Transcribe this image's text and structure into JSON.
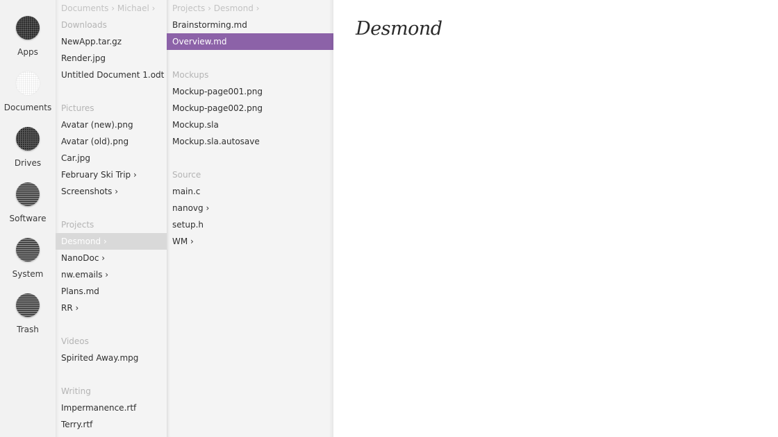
{
  "dock": [
    {
      "label": "Apps",
      "icon": "apps-icon"
    },
    {
      "label": "Documents",
      "icon": "documents-icon"
    },
    {
      "label": "Drives",
      "icon": "drives-icon"
    },
    {
      "label": "Software",
      "icon": "software-icon"
    },
    {
      "label": "System",
      "icon": "system-icon"
    },
    {
      "label": "Trash",
      "icon": "trash-icon"
    }
  ],
  "column1": {
    "breadcrumb": "Documents › Michael ›",
    "rows": [
      {
        "type": "header",
        "text": "Downloads"
      },
      {
        "type": "item",
        "text": "NewApp.tar.gz"
      },
      {
        "type": "item",
        "text": "Render.jpg"
      },
      {
        "type": "item",
        "text": "Untitled Document 1.odt"
      },
      {
        "type": "spacer",
        "text": ""
      },
      {
        "type": "header",
        "text": "Pictures"
      },
      {
        "type": "item",
        "text": "Avatar (new).png"
      },
      {
        "type": "item",
        "text": "Avatar (old).png"
      },
      {
        "type": "item",
        "text": "Car.jpg"
      },
      {
        "type": "item",
        "text": "February Ski Trip ›"
      },
      {
        "type": "item",
        "text": "Screenshots ›"
      },
      {
        "type": "spacer",
        "text": ""
      },
      {
        "type": "header",
        "text": "Projects"
      },
      {
        "type": "item",
        "text": "Desmond ›",
        "selected": "gray"
      },
      {
        "type": "item",
        "text": "NanoDoc ›"
      },
      {
        "type": "item",
        "text": "nw.emails ›"
      },
      {
        "type": "item",
        "text": "Plans.md"
      },
      {
        "type": "item",
        "text": "RR ›"
      },
      {
        "type": "spacer",
        "text": ""
      },
      {
        "type": "header",
        "text": "Videos"
      },
      {
        "type": "item",
        "text": "Spirited Away.mpg"
      },
      {
        "type": "spacer",
        "text": ""
      },
      {
        "type": "header",
        "text": "Writing"
      },
      {
        "type": "item",
        "text": "Impermanence.rtf"
      },
      {
        "type": "item",
        "text": "Terry.rtf"
      }
    ]
  },
  "column2": {
    "breadcrumb": "Projects › Desmond ›",
    "rows": [
      {
        "type": "item",
        "text": "Brainstorming.md"
      },
      {
        "type": "item",
        "text": "Overview.md",
        "selected": "purple"
      },
      {
        "type": "spacer",
        "text": ""
      },
      {
        "type": "header",
        "text": "Mockups"
      },
      {
        "type": "item",
        "text": "Mockup-page001.png"
      },
      {
        "type": "item",
        "text": "Mockup-page002.png"
      },
      {
        "type": "item",
        "text": "Mockup.sla"
      },
      {
        "type": "item",
        "text": "Mockup.sla.autosave"
      },
      {
        "type": "spacer",
        "text": ""
      },
      {
        "type": "header",
        "text": "Source"
      },
      {
        "type": "item",
        "text": "main.c"
      },
      {
        "type": "item",
        "text": "nanovg ›"
      },
      {
        "type": "item",
        "text": "setup.h"
      },
      {
        "type": "item",
        "text": "WM ›"
      }
    ]
  },
  "document": {
    "title": "Desmond"
  },
  "colors": {
    "selection_purple": "#8c62a8",
    "selection_gray": "#d9d9d9",
    "panel_bg": "#f4f4f4",
    "header_text": "#b4b4b4"
  }
}
